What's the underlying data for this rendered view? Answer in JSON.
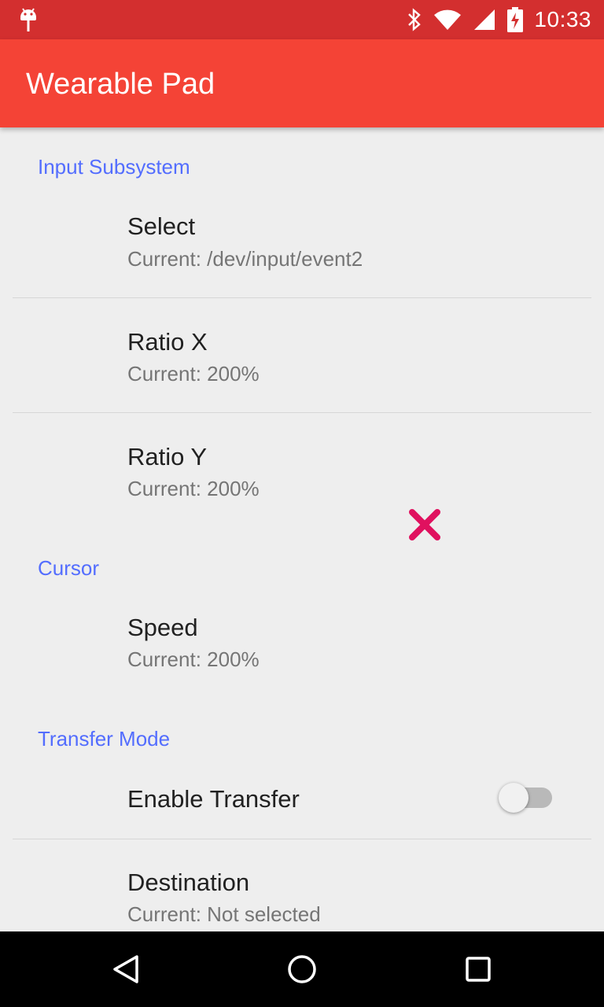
{
  "status_bar": {
    "time": "10:33",
    "icons": [
      "android-debug-icon",
      "bluetooth-icon",
      "wifi-icon",
      "signal-icon",
      "battery-charging-icon"
    ]
  },
  "app_bar": {
    "title": "Wearable Pad"
  },
  "sections": {
    "input_subsystem": {
      "header": "Input Subsystem",
      "select": {
        "title": "Select",
        "summary": "Current: /dev/input/event2"
      },
      "ratio_x": {
        "title": "Ratio X",
        "summary": "Current: 200%"
      },
      "ratio_y": {
        "title": "Ratio Y",
        "summary": "Current: 200%"
      }
    },
    "cursor": {
      "header": "Cursor",
      "speed": {
        "title": "Speed",
        "summary": "Current: 200%"
      }
    },
    "transfer_mode": {
      "header": "Transfer Mode",
      "enable_transfer": {
        "title": "Enable Transfer",
        "checked": false
      },
      "destination": {
        "title": "Destination",
        "summary": "Current: Not selected"
      }
    }
  },
  "overlay": {
    "icon": "close-x-icon",
    "color": "#e0115f"
  },
  "nav_bar": {
    "icons": [
      "back-icon",
      "home-icon",
      "recents-icon"
    ]
  },
  "colors": {
    "status_bar": "#d32f2f",
    "app_bar": "#f44336",
    "category": "#536dfe"
  }
}
